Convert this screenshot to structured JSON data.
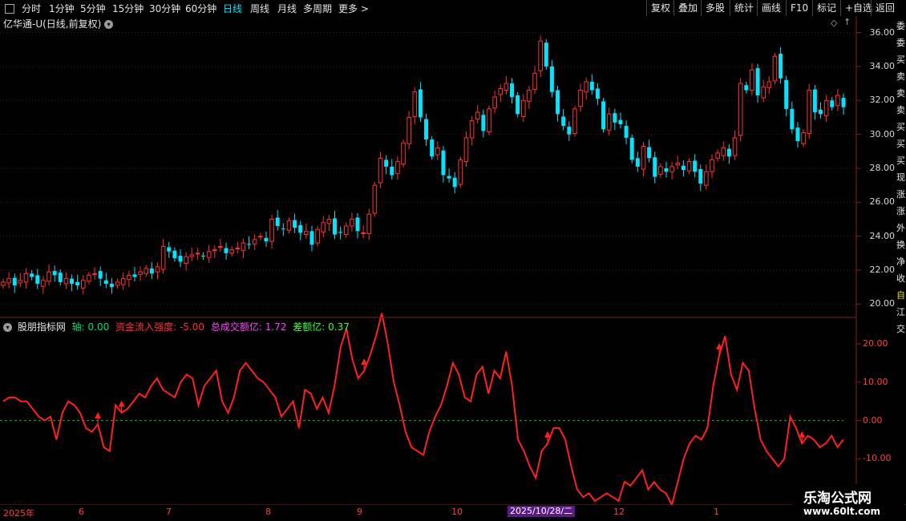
{
  "toolbar": {
    "periods": [
      {
        "label": "分时",
        "active": false
      },
      {
        "label": "1分钟",
        "active": false
      },
      {
        "label": "5分钟",
        "active": false
      },
      {
        "label": "15分钟",
        "active": false
      },
      {
        "label": "30分钟",
        "active": false
      },
      {
        "label": "60分钟",
        "active": false
      },
      {
        "label": "日线",
        "active": true
      },
      {
        "label": "周线",
        "active": false
      },
      {
        "label": "月线",
        "active": false
      },
      {
        "label": "多周期",
        "active": false
      },
      {
        "label": "更多",
        "active": false
      }
    ],
    "right": [
      "复权",
      "叠加",
      "多股",
      "统计",
      "画线",
      "F10",
      "标记",
      "+自选",
      "返回"
    ]
  },
  "stock_title": "亿华通-U(日线,前复权)",
  "indicator": {
    "name": "股朋指标网",
    "axis_label": "轴:",
    "axis_value": "0.00",
    "flow_label": "资金流入强度:",
    "flow_value": "-5.00",
    "volume_label": "总成交额亿:",
    "volume_value": "1.72",
    "diff_label": "差额亿:",
    "diff_value": "0.37"
  },
  "price_axis": [
    "36.00",
    "34.00",
    "32.00",
    "30.00",
    "28.00",
    "26.00",
    "24.00",
    "22.00",
    "20.00"
  ],
  "indicator_axis": [
    "20.00",
    "10.00",
    "0.00",
    "-10.00"
  ],
  "x_labels": [
    "2025年",
    "6",
    "7",
    "8",
    "9",
    "10",
    "12",
    "1"
  ],
  "crosshair_date": "2025/10/28/二",
  "watermark": {
    "line1": "乐淘公式网",
    "line2": "www.60lt.com"
  },
  "side_chars": [
    "委",
    "委",
    "买",
    "卖",
    "卖",
    "卖",
    "买",
    "买",
    "买",
    "现",
    "涨",
    "涨",
    "外",
    "换",
    "净",
    "收",
    "自",
    "江",
    "交"
  ],
  "colors": {
    "up": "#ff3232",
    "down": "#00e5ff",
    "line": "#ff2020",
    "zero": "#00c800",
    "accent": "#00e5ff"
  },
  "chart_data": {
    "type": "candlestick",
    "ylim": [
      19.5,
      36.5
    ],
    "indicator_ylim": [
      -21,
      25
    ],
    "close_series": [
      21.3,
      21.5,
      21.1,
      21.4,
      21.8,
      21.6,
      21.2,
      21.4,
      21.9,
      21.7,
      21.3,
      21.5,
      21.2,
      21.1,
      21.4,
      21.7,
      21.8,
      21.5,
      21.2,
      21.0,
      21.3,
      21.5,
      21.7,
      21.6,
      21.9,
      22.1,
      21.8,
      22.2,
      23.4,
      23.1,
      22.7,
      22.5,
      22.8,
      22.9,
      23.0,
      22.8,
      23.1,
      23.2,
      23.4,
      23.0,
      23.2,
      23.3,
      23.6,
      23.5,
      23.8,
      24.0,
      23.7,
      25.0,
      24.6,
      24.4,
      24.9,
      24.5,
      24.2,
      24.3,
      23.5,
      24.4,
      24.8,
      25.0,
      24.1,
      24.2,
      24.6,
      25.0,
      24.3,
      24.2,
      25.3,
      27.0,
      28.6,
      28.1,
      27.6,
      28.4,
      29.5,
      31.0,
      32.5,
      31.0,
      29.7,
      28.7,
      29.2,
      27.6,
      27.4,
      26.9,
      28.5,
      29.8,
      30.8,
      31.3,
      30.2,
      31.5,
      32.2,
      32.7,
      33.0,
      32.2,
      31.2,
      32.0,
      32.6,
      33.6,
      35.5,
      34.0,
      32.5,
      31.2,
      30.5,
      30.0,
      31.5,
      32.6,
      33.1,
      32.6,
      32.1,
      30.3,
      31.2,
      30.7,
      30.6,
      29.8,
      28.5,
      28.1,
      29.3,
      28.6,
      27.5,
      28.1,
      27.8,
      28.1,
      28.3,
      27.9,
      28.4,
      27.8,
      27.1,
      27.8,
      28.5,
      28.9,
      29.2,
      28.7,
      29.8,
      33.0,
      32.6,
      33.8,
      32.3,
      32.8,
      33.1,
      34.6,
      33.3,
      31.5,
      30.3,
      29.6,
      30.1,
      32.6,
      31.3,
      31.2,
      32.0,
      31.6,
      32.3,
      31.6
    ],
    "indicator_series": [
      5,
      6,
      6,
      5,
      5,
      3,
      1,
      0,
      1,
      -5,
      2,
      5,
      4,
      2,
      -2,
      -3,
      -1,
      -7,
      -8,
      4,
      2,
      3,
      5,
      7,
      6,
      9,
      11,
      8,
      7,
      6,
      10,
      12,
      11,
      4,
      9,
      11,
      13,
      5,
      2,
      6,
      13,
      15,
      13,
      11,
      10,
      8,
      6,
      1,
      3,
      5,
      -2,
      8,
      7,
      3,
      6,
      2,
      9,
      19,
      24,
      16,
      11,
      13,
      17,
      22,
      28,
      20,
      10,
      4,
      -3,
      -7,
      -8,
      -9,
      -3,
      1,
      4,
      9,
      15,
      12,
      6,
      5,
      12,
      14,
      7,
      13,
      11,
      18,
      9,
      -5,
      -8,
      -12,
      -15,
      -8,
      -6,
      -2,
      -2,
      -5,
      -12,
      -18,
      -20,
      -19,
      -21,
      -20,
      -19,
      -20,
      -21,
      -16,
      -17,
      -15,
      -13,
      -18,
      -16,
      -18,
      -19,
      -22,
      -16,
      -10,
      -6,
      -4,
      -5,
      -2,
      9,
      17,
      22,
      12,
      8,
      15,
      13,
      3,
      -5,
      -8,
      -10,
      -12,
      -10,
      1,
      -2,
      -6,
      -4,
      -5,
      -7,
      -6,
      -4,
      -7,
      -5
    ]
  }
}
